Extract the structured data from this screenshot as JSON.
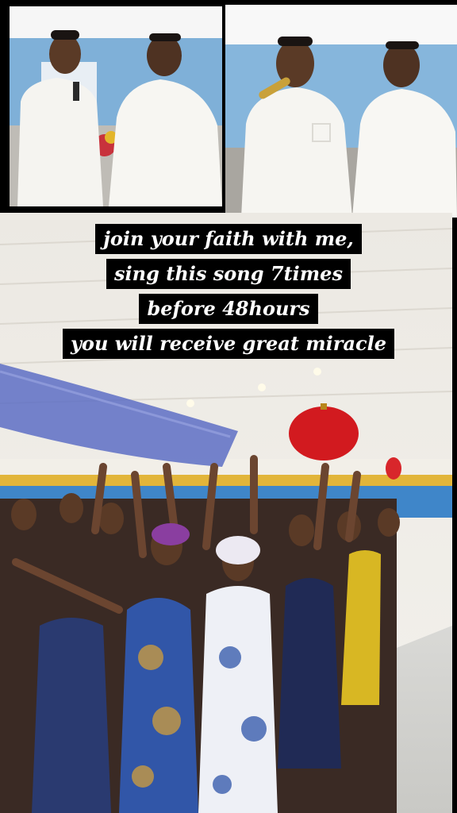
{
  "caption": {
    "lines": [
      "join your faith with me,",
      "sing this song 7times",
      "before 48hours",
      "you will receive great miracle"
    ]
  },
  "colors": {
    "background": "#000000",
    "caption_bg": "#000000",
    "caption_text": "#ffffff",
    "wall_blue": "#3f86c9",
    "robe_white": "#f4f2ee",
    "lantern_red": "#d21a1f",
    "drape_blue": "#5d6fc4"
  },
  "photos": [
    {
      "name": "two-men-photo-left"
    },
    {
      "name": "two-men-photo-right"
    },
    {
      "name": "congregation-worship-photo"
    }
  ]
}
